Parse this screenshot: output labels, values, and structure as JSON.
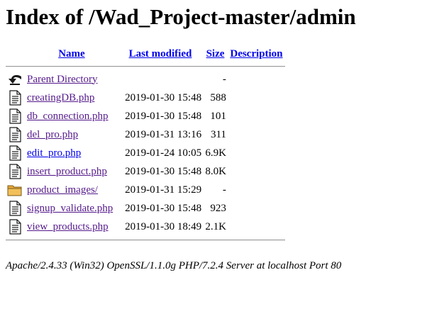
{
  "heading": "Index of /Wad_Project-master/admin",
  "columns": {
    "name": "Name",
    "last_modified": "Last modified",
    "size": "Size",
    "description": "Description"
  },
  "parent": {
    "label": "Parent Directory",
    "size": "-",
    "icon": "back-arrow-icon"
  },
  "entries": [
    {
      "name": "creatingDB.php",
      "modified": "2019-01-30 15:48",
      "size": "588",
      "icon": "file-icon"
    },
    {
      "name": "db_connection.php",
      "modified": "2019-01-30 15:48",
      "size": "101",
      "icon": "file-icon"
    },
    {
      "name": "del_pro.php",
      "modified": "2019-01-31 13:16",
      "size": "311",
      "icon": "file-icon"
    },
    {
      "name": "edit_pro.php",
      "modified": "2019-01-24 10:05",
      "size": "6.9K",
      "icon": "file-icon"
    },
    {
      "name": "insert_product.php",
      "modified": "2019-01-30 15:48",
      "size": "8.0K",
      "icon": "file-icon"
    },
    {
      "name": "product_images/",
      "modified": "2019-01-31 15:29",
      "size": "-",
      "icon": "folder-icon"
    },
    {
      "name": "signup_validate.php",
      "modified": "2019-01-30 15:48",
      "size": "923",
      "icon": "file-icon"
    },
    {
      "name": "view_products.php",
      "modified": "2019-01-30 18:49",
      "size": "2.1K",
      "icon": "file-icon"
    }
  ],
  "footer": "Apache/2.4.33 (Win32) OpenSSL/1.1.0g PHP/7.2.4 Server at localhost Port 80",
  "colors": {
    "link": "#0000ee",
    "visited_link": "#551a8b",
    "folder": "#e8a93a"
  }
}
